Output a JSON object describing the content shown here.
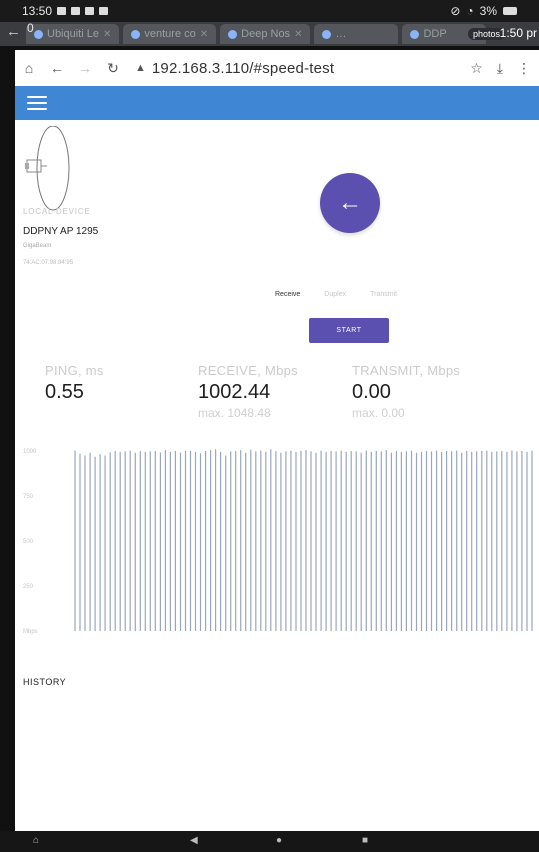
{
  "statusbar": {
    "time": "13:50",
    "battery": "3%"
  },
  "tabs": {
    "count": "0",
    "items": [
      {
        "label": "Ubiquiti Le"
      },
      {
        "label": "venture co"
      },
      {
        "label": "Deep Nos"
      },
      {
        "label": "…"
      },
      {
        "label": "DDP"
      }
    ],
    "overlay_badge": "photos",
    "overlay_clock": "1:50 pr"
  },
  "address_bar": {
    "url": "192.168.3.110/#speed-test"
  },
  "device": {
    "section_label": "LOCAL DEVICE",
    "name": "DDPNY AP 1295",
    "model": "GigaBeam",
    "mac": "74:AC:07:98:84:95"
  },
  "test": {
    "modes": [
      {
        "label": "Receive",
        "active": true
      },
      {
        "label": "Duplex",
        "active": false
      },
      {
        "label": "Transmit",
        "active": false
      }
    ],
    "start_label": "START"
  },
  "metrics": {
    "ping": {
      "label": "PING, ms",
      "value": "0.55"
    },
    "receive": {
      "label": "RECEIVE, Mbps",
      "value": "1002.44",
      "max": "max. 1048.48"
    },
    "transmit": {
      "label": "TRANSMIT, Mbps",
      "value": "0.00",
      "max": "max. 0.00"
    }
  },
  "chart_data": {
    "type": "bar",
    "y_ticks": [
      "1000",
      "750",
      "500",
      "250",
      "Mbps"
    ],
    "ylim": [
      0,
      1000
    ],
    "series": [
      {
        "values": [
          1002,
          985,
          975,
          990,
          968,
          982,
          975,
          992,
          1000,
          995,
          998,
          1002,
          990,
          1000,
          995,
          998,
          1000,
          992,
          1005,
          995,
          1000,
          990,
          1002,
          1000,
          995,
          988,
          1000,
          1005,
          1010,
          995,
          975,
          998,
          1000,
          1005,
          990,
          1008,
          998,
          1002,
          995,
          1010,
          1000,
          990,
          998,
          1002,
          995,
          1000,
          1005,
          998,
          990,
          1002,
          995,
          1000,
          998,
          1002,
          995,
          1000,
          998,
          990,
          1002,
          995,
          1000,
          998,
          1005,
          990,
          1000,
          995,
          998,
          1002,
          990,
          995,
          1000,
          998,
          1002,
          995,
          1000,
          998,
          1002,
          990,
          1000,
          995,
          998,
          1000,
          1002,
          995,
          998,
          1000,
          995,
          1002,
          998,
          1000,
          995,
          1002
        ]
      }
    ]
  },
  "history": {
    "title": "HISTORY"
  }
}
